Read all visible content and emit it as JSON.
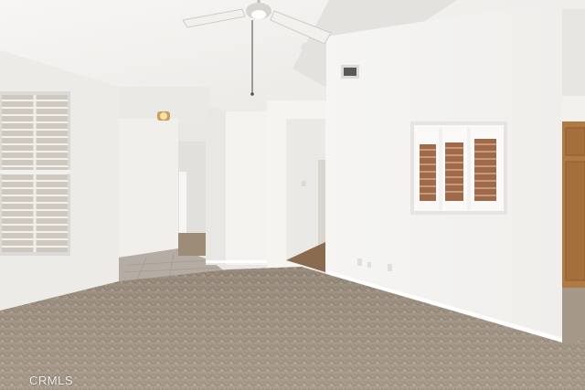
{
  "photo": {
    "scene": "empty-room-interior",
    "watermark_text": "CRMLS",
    "colors": {
      "wall": "#f3f2ef",
      "ceiling": "#f5f4f2",
      "carpet": "#a89a8a",
      "shutter": "#a16d4f",
      "tile": "#b7afa6",
      "cabinet": "#b07a45"
    }
  }
}
